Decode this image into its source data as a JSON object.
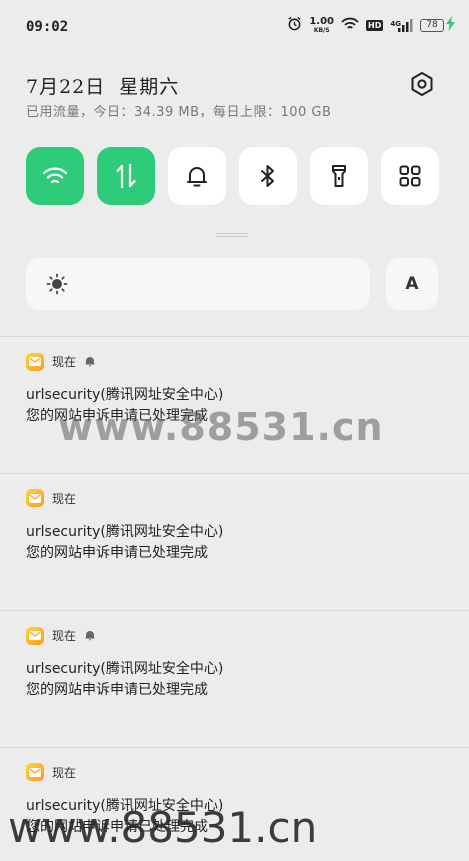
{
  "status_bar": {
    "time": "09:02",
    "net_speed_value": "1.00",
    "net_speed_unit": "KB/S",
    "hd_label": "HD",
    "network_type": "4G",
    "battery_level": "78",
    "icons": [
      "alarm-icon",
      "wifi-icon",
      "signal-icon",
      "charging-icon"
    ]
  },
  "header": {
    "date": "7月22日",
    "weekday": "星期六",
    "data_usage": "已用流量，今日：34.39 MB，每日上限：100 GB"
  },
  "quick_settings": {
    "tiles": [
      {
        "name": "wifi",
        "icon": "wifi-icon",
        "active": true
      },
      {
        "name": "mobile-data",
        "icon": "data-arrows-icon",
        "active": true
      },
      {
        "name": "sound",
        "icon": "bell-icon",
        "active": false
      },
      {
        "name": "bluetooth",
        "icon": "bluetooth-icon",
        "active": false
      },
      {
        "name": "flashlight",
        "icon": "flashlight-icon",
        "active": false
      },
      {
        "name": "more",
        "icon": "grid-icon",
        "active": false
      }
    ],
    "active_color": "#2ecc7a"
  },
  "brightness": {
    "icon": "sun-icon",
    "auto_label": "A"
  },
  "notifications": [
    {
      "time": "现在",
      "muted": true,
      "title": "urlsecurity(腾讯网址安全中心)",
      "body": "您的网站申诉申请已处理完成"
    },
    {
      "time": "现在",
      "muted": false,
      "title": "urlsecurity(腾讯网址安全中心)",
      "body": "您的网站申诉申请已处理完成"
    },
    {
      "time": "现在",
      "muted": true,
      "title": "urlsecurity(腾讯网址安全中心)",
      "body": "您的网站申诉申请已处理完成"
    },
    {
      "time": "现在",
      "muted": false,
      "title": "urlsecurity(腾讯网址安全中心)",
      "body": "您的网站申诉申请已处理完成"
    }
  ],
  "watermarks": {
    "top": "www.88531.cn",
    "bottom": "www.88531.cn"
  }
}
